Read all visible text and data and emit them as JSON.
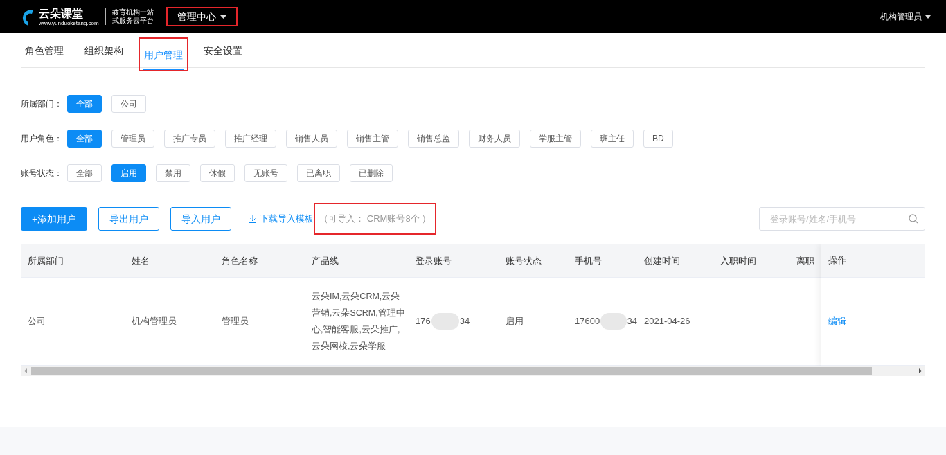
{
  "header": {
    "logo_name": "云朵课堂",
    "logo_url": "www.yunduoketang.com",
    "slogan_line_1": "教育机构一站",
    "slogan_line_2": "式服务云平台",
    "menu": {
      "label": "管理中心",
      "highlighted": true
    },
    "user": "机构管理员"
  },
  "tabs": [
    {
      "label": "角色管理",
      "selected": false,
      "highlighted": false
    },
    {
      "label": "组织架构",
      "selected": false,
      "highlighted": false
    },
    {
      "label": "用户管理",
      "selected": true,
      "highlighted": true
    },
    {
      "label": "安全设置",
      "selected": false,
      "highlighted": false
    }
  ],
  "filters": [
    {
      "label": "所属部门：",
      "options": [
        {
          "label": "全部",
          "selected": true
        },
        {
          "label": "公司",
          "selected": false
        }
      ]
    },
    {
      "label": "用户角色：",
      "options": [
        {
          "label": "全部",
          "selected": true
        },
        {
          "label": "管理员",
          "selected": false
        },
        {
          "label": "推广专员",
          "selected": false
        },
        {
          "label": "推广经理",
          "selected": false
        },
        {
          "label": "销售人员",
          "selected": false
        },
        {
          "label": "销售主管",
          "selected": false
        },
        {
          "label": "销售总监",
          "selected": false
        },
        {
          "label": "财务人员",
          "selected": false
        },
        {
          "label": "学服主管",
          "selected": false
        },
        {
          "label": "班主任",
          "selected": false
        },
        {
          "label": "BD",
          "selected": false
        }
      ]
    },
    {
      "label": "账号状态：",
      "options": [
        {
          "label": "全部",
          "selected": false
        },
        {
          "label": "启用",
          "selected": true
        },
        {
          "label": "禁用",
          "selected": false
        },
        {
          "label": "休假",
          "selected": false
        },
        {
          "label": "无账号",
          "selected": false
        },
        {
          "label": "已离职",
          "selected": false
        },
        {
          "label": "已删除",
          "selected": false
        }
      ]
    }
  ],
  "toolbar": {
    "buttons": [
      {
        "label": "+添加用户",
        "kind": "primary"
      },
      {
        "label": "导出用户",
        "kind": "outline"
      },
      {
        "label": "导入用户",
        "kind": "outline"
      }
    ],
    "download_link": "下载导入模板",
    "import_note": {
      "text": "（可导入： CRM账号8个 ）",
      "highlighted": true
    },
    "search": {
      "placeholder": "登录账号/姓名/手机号"
    }
  },
  "table": {
    "columns": [
      "所属部门",
      "姓名",
      "角色名称",
      "产品线",
      "登录账号",
      "账号状态",
      "手机号",
      "创建时间",
      "入职时间",
      "离职"
    ],
    "action_column": "操作",
    "rows": [
      {
        "cells": [
          {
            "kind": "text",
            "text": "公司"
          },
          {
            "kind": "text",
            "text": "机构管理员"
          },
          {
            "kind": "text",
            "text": "管理员"
          },
          {
            "kind": "text",
            "text": "云朵IM,云朵CRM,云朵营销,云朵SCRM,管理中心,智能客服,云朵推广,云朵网校,云朵学服"
          },
          {
            "kind": "masked",
            "start": "176",
            "end": "34"
          },
          {
            "kind": "text",
            "text": "启用"
          },
          {
            "kind": "masked",
            "start": "17600",
            "end": "34"
          },
          {
            "kind": "text",
            "text": "2021-04-26"
          },
          {
            "kind": "empty"
          },
          {
            "kind": "empty"
          }
        ],
        "action": "编辑"
      }
    ]
  }
}
